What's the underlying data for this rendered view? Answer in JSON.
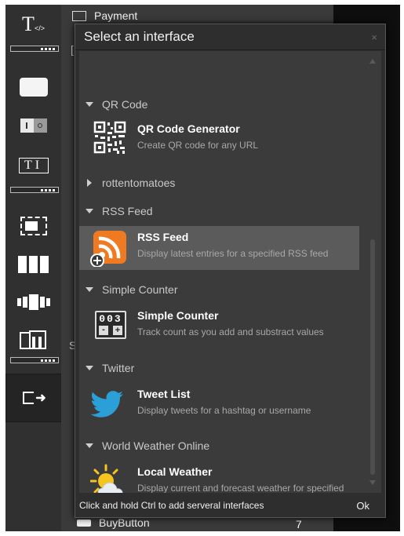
{
  "background": {
    "payment_label": "Payment",
    "bracket_fragment": "[",
    "s_fragment": "S",
    "buybutton_label": "BuyButton",
    "buybutton_count": "7"
  },
  "toolbox": {
    "tools": [
      {
        "icon": "text-code-icon",
        "label": "T</>"
      },
      {
        "icon": "button-icon"
      },
      {
        "icon": "toggle-icon"
      },
      {
        "icon": "text-input-icon",
        "label": "T I"
      },
      {
        "icon": "frame-icon"
      },
      {
        "icon": "columns-icon"
      },
      {
        "icon": "slider-icon"
      },
      {
        "icon": "tabs-icon"
      },
      {
        "icon": "export-icon"
      }
    ]
  },
  "modal": {
    "title": "Select an interface",
    "close": "×",
    "footer_hint": "Click and hold Ctrl to add serveral interfaces",
    "ok_label": "Ok",
    "groups": [
      {
        "name": "QR Code",
        "expanded": true
      },
      {
        "name": "rottentomatoes",
        "expanded": false
      },
      {
        "name": "RSS Feed",
        "expanded": true
      },
      {
        "name": "Simple Counter",
        "expanded": true
      },
      {
        "name": "Twitter",
        "expanded": true
      },
      {
        "name": "World Weather Online",
        "expanded": true
      }
    ],
    "items": [
      {
        "name": "QR Code Generator",
        "desc": "Create QR code for any URL",
        "icon": "qr-code-icon"
      },
      {
        "name": "RSS Feed",
        "desc": "Display latest entries for a specified RSS feed",
        "icon": "rss-feed-icon",
        "selected": true
      },
      {
        "name": "Simple Counter",
        "desc": "Track count as you add and substract values",
        "icon": "counter-icon",
        "counter_digits": "003"
      },
      {
        "name": "Tweet List",
        "desc": "Display tweets for a hashtag or username",
        "icon": "twitter-bird-icon"
      },
      {
        "name": "Local Weather",
        "desc": "Display current and forecast weather for specified city",
        "icon": "weather-sun-cloud-icon"
      }
    ]
  },
  "colors": {
    "rss_orange": "#f07a22",
    "twitter_blue": "#2a9fd8",
    "sun_yellow": "#f6c41e",
    "selected_row": "#5b5b5b"
  }
}
